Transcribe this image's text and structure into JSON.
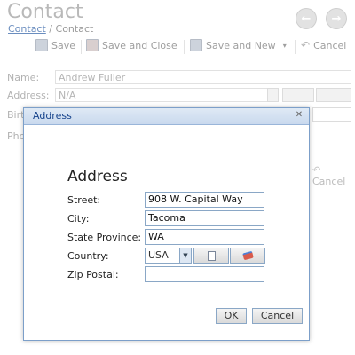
{
  "header": {
    "title": "Contact"
  },
  "breadcrumb": {
    "link": "Contact",
    "separator": "/",
    "current": "Contact"
  },
  "toolbar": {
    "save": "Save",
    "save_close": "Save and Close",
    "save_new": "Save and New",
    "cancel": "Cancel"
  },
  "form": {
    "name_label": "Name:",
    "name_value": "Andrew Fuller",
    "address_label": "Address:",
    "address_value": "N/A",
    "birth_label": "Birt",
    "phone_label": "Pho",
    "cancel_partial": "Cancel"
  },
  "dialog": {
    "title": "Address",
    "heading": "Address",
    "street_label": "Street:",
    "street_value": "908 W. Capital Way",
    "city_label": "City:",
    "city_value": "Tacoma",
    "state_label": "State Province:",
    "state_value": "WA",
    "country_label": "Country:",
    "country_value": "USA",
    "zip_label": "Zip Postal:",
    "zip_value": "",
    "ok": "OK",
    "cancel": "Cancel"
  }
}
